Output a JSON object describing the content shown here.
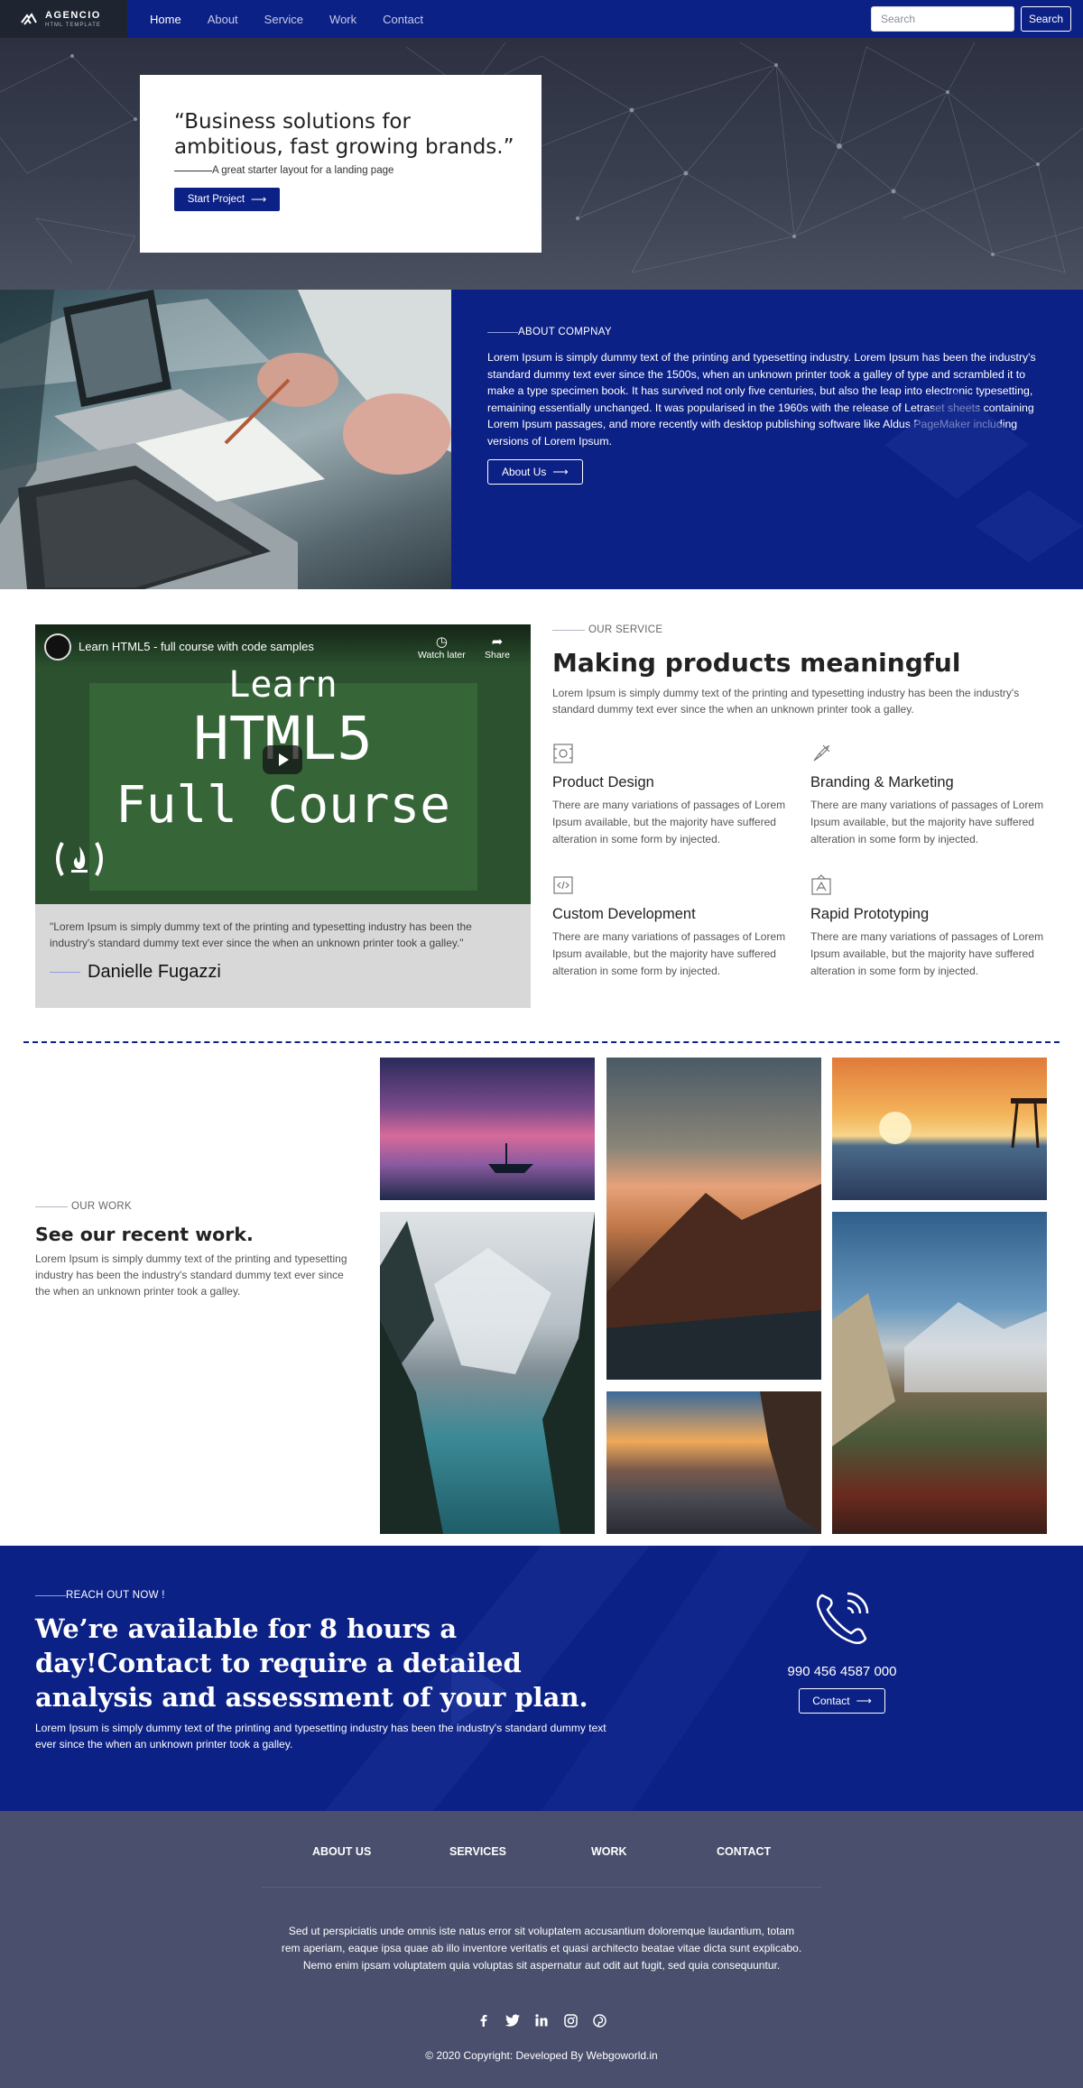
{
  "nav": {
    "brand": "AGENCIO",
    "brand_sub": "HTML TEMPLATE",
    "links": [
      "Home",
      "About",
      "Service",
      "Work",
      "Contact"
    ],
    "active": "Home",
    "search_placeholder": "Search",
    "search_button": "Search"
  },
  "hero": {
    "quote": "“Business solutions for ambitious, fast growing brands.”",
    "subtitle": "A great starter layout for a landing page",
    "button": "Start Project"
  },
  "about": {
    "eyebrow": "ABOUT COMPNAY",
    "text": "Lorem Ipsum is simply dummy text of the printing and typesetting industry. Lorem Ipsum has been the industry's standard dummy text ever since the 1500s, when an unknown printer took a galley of type and scrambled it to make a type specimen book. It has survived not only five centuries, but also the leap into electronic typesetting, remaining essentially unchanged. It was popularised in the 1960s with the release of Letraset sheets containing Lorem Ipsum passages, and more recently with desktop publishing software like Aldus PageMaker including versions of Lorem Ipsum.",
    "button": "About Us"
  },
  "video": {
    "title": "Learn HTML5 - full course with code samples",
    "watch_later": "Watch later",
    "share": "Share",
    "big_line1": "Learn",
    "big_line2": "HTML5",
    "big_line3": "Full Course"
  },
  "testimonial": {
    "quote": "\"Lorem Ipsum is simply dummy text of the printing and typesetting industry has been the industry's standard dummy text ever since the when an unknown printer took a galley.\"",
    "author": "Danielle Fugazzi"
  },
  "service": {
    "eyebrow": "OUR SERVICE",
    "title": "Making products meaningful",
    "text": "Lorem Ipsum is simply dummy text of the printing and typesetting industry has been the industry's standard dummy text ever since the when an unknown printer took a galley.",
    "features": [
      {
        "icon": "design-icon",
        "title": "Product Design",
        "text": "There are many variations of passages of Lorem Ipsum available, but the majority have suffered alteration in some form by injected."
      },
      {
        "icon": "pen-icon",
        "title": "Branding & Marketing",
        "text": "There are many variations of passages of Lorem Ipsum available, but the majority have suffered alteration in some form by injected."
      },
      {
        "icon": "code-icon",
        "title": "Custom Development",
        "text": "There are many variations of passages of Lorem Ipsum available, but the majority have suffered alteration in some form by injected."
      },
      {
        "icon": "prototype-icon",
        "title": "Rapid Prototyping",
        "text": "There are many variations of passages of Lorem Ipsum available, but the majority have suffered alteration in some form by injected."
      }
    ]
  },
  "work": {
    "eyebrow": "OUR WORK",
    "title": "See our recent work.",
    "text": "Lorem Ipsum is simply dummy text of the printing and typesetting industry has been the industry's standard dummy text ever since the when an unknown printer took a galley."
  },
  "contact": {
    "eyebrow": "REACH OUT NOW !",
    "title": "We’re available for 8 hours a day!Contact to require a detailed analysis and assessment of your plan.",
    "text": "Lorem Ipsum is simply dummy text of the printing and typesetting industry has been the industry's standard dummy text ever since the when an unknown printer took a galley.",
    "phone": "990 456 4587 000",
    "button": "Contact"
  },
  "footer": {
    "links": [
      "ABOUT US",
      "SERVICES",
      "WORK",
      "CONTACT"
    ],
    "text": "Sed ut perspiciatis unde omnis iste natus error sit voluptatem accusantium doloremque laudantium, totam rem aperiam, eaque ipsa quae ab illo inventore veritatis et quasi architecto beatae vitae dicta sunt explicabo. Nemo enim ipsam voluptatem quia voluptas sit aspernatur aut odit aut fugit, sed quia consequuntur.",
    "social": [
      "facebook-icon",
      "twitter-icon",
      "linkedin-icon",
      "instagram-icon",
      "pinterest-icon"
    ],
    "copyright": "© 2020 Copyright: Developed By Webgoworld.in"
  },
  "colors": {
    "primary": "#0c2185",
    "footer": "#494f6c",
    "testimonial_bg": "#d8d8d8"
  }
}
